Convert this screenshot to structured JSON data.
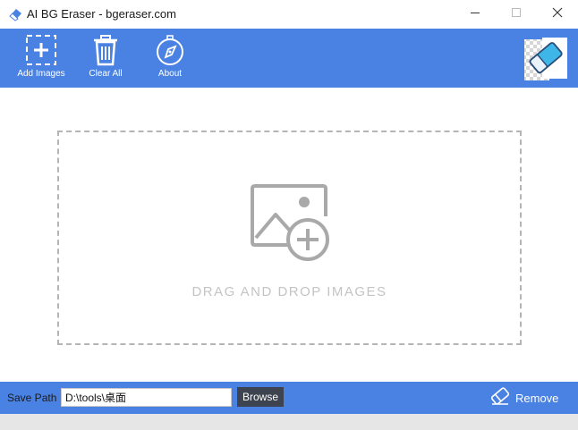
{
  "window": {
    "title": "AI BG Eraser - bgeraser.com",
    "minimize_icon": "minimize-icon",
    "maximize_icon": "maximize-icon",
    "close_icon": "close-icon"
  },
  "toolbar": {
    "items": [
      {
        "label": "Add Images",
        "icon": "add-image-icon"
      },
      {
        "label": "Clear All",
        "icon": "trash-icon"
      },
      {
        "label": "About",
        "icon": "compass-icon"
      }
    ],
    "logo_icon": "eraser-logo-icon"
  },
  "dropzone": {
    "text": "DRAG AND DROP IMAGES",
    "icon": "image-add-icon"
  },
  "bottombar": {
    "save_label": "Save Path",
    "path_value": "D:\\tools\\桌面",
    "browse_label": "Browse",
    "remove_label": "Remove",
    "remove_icon": "eraser-icon"
  },
  "colors": {
    "accent": "#4a82e3",
    "browse_bg": "#3e4350",
    "dropzone_border": "#b5b5b5",
    "dropzone_text": "#c4c4c4"
  }
}
